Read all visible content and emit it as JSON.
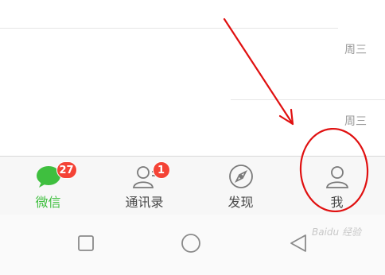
{
  "chat_list": {
    "rows": [
      {
        "time": "周三"
      },
      {
        "time": "周三"
      }
    ]
  },
  "tabbar": {
    "tabs": [
      {
        "label": "微信",
        "badge": "27",
        "icon": "chat-bubble-icon",
        "active": true
      },
      {
        "label": "通讯录",
        "badge": "1",
        "icon": "contacts-icon",
        "active": false
      },
      {
        "label": "发现",
        "badge": "",
        "icon": "compass-icon",
        "active": false
      },
      {
        "label": "我",
        "badge": "",
        "icon": "person-icon",
        "active": false
      }
    ]
  },
  "navbar": {
    "buttons": [
      "recents-square-icon",
      "home-circle-icon",
      "back-triangle-icon"
    ]
  },
  "annotation": {
    "color": "#e01010"
  },
  "watermark": {
    "text": "Baidu 经验"
  },
  "colors": {
    "active": "#3fbf3f",
    "inactive": "#4a4a4a",
    "badge": "#f44336"
  }
}
